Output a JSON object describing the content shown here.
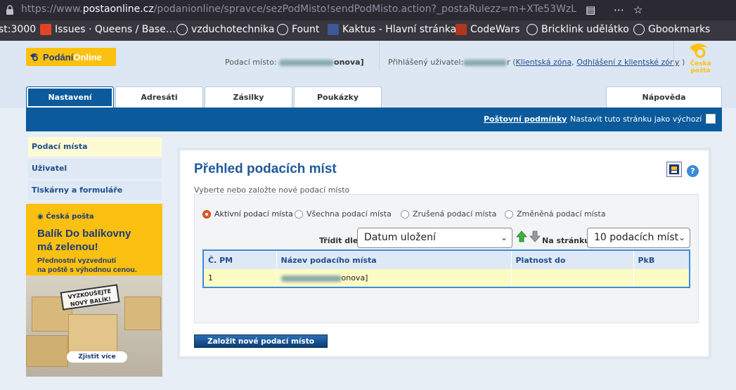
{
  "browser": {
    "url_prefix": "https://www.",
    "url_host": "postaonline.cz",
    "url_path": "/podanionline/spravce/sezPodMisto!sendPodMisto.action?_postaRulezz=m+XTe53WzL",
    "bookmarks": [
      {
        "label": "st:3000"
      },
      {
        "label": "Issues · Queens / Base…"
      },
      {
        "label": "vzduchotechnika"
      },
      {
        "label": "Fount"
      },
      {
        "label": "Kaktus - Hlavní stránka"
      },
      {
        "label": "CodeWars"
      },
      {
        "label": "Bricklink udělátko"
      },
      {
        "label": "Gbookmarks"
      }
    ]
  },
  "header": {
    "logo_part1": "Podání",
    "logo_part2": "Online",
    "podaci_misto_label": "Podací místo:",
    "podaci_misto_value": "onova]",
    "user_label": "Přihlášený uživatel:",
    "user_value": "r",
    "client_zone_link": "Klientská zóna",
    "logout_link": "Odhlášení z klientské zóny",
    "cp_logo": "Česká pošta"
  },
  "tabs": [
    {
      "label": "Nastavení"
    },
    {
      "label": "Adresáti"
    },
    {
      "label": "Zásilky"
    },
    {
      "label": "Poukázky"
    },
    {
      "label": "Nápověda"
    }
  ],
  "bluebar": {
    "conditions_link": "Poštovní podmínky",
    "set_default_label": "Nastavit tuto stránku jako výchozí"
  },
  "sidebar": {
    "items": [
      {
        "label": "Podací místa"
      },
      {
        "label": "Uživatel"
      },
      {
        "label": "Tiskárny a formuláře"
      }
    ]
  },
  "banner": {
    "brand": "Česká pošta",
    "headline_1": "Balík Do balíkovny",
    "headline_2": "má zelenou!",
    "text_1": "Přednostní vyzvednutí",
    "text_2": "na poště s výhodnou cenou.",
    "stamp_1": "VYZKOUŠEJTE",
    "stamp_2": "NOVÝ BALÍK!",
    "cta": "Zjistit více"
  },
  "main": {
    "title": "Přehled podacích míst",
    "subtitle": "Vyberte nebo založte nové podací místo",
    "help": "?",
    "filters": [
      {
        "label": "Aktivní podací místa",
        "selected": true
      },
      {
        "label": "Všechna podací místa",
        "selected": false
      },
      {
        "label": "Zrušená podací místa",
        "selected": false
      },
      {
        "label": "Změněná podací místa",
        "selected": false
      }
    ],
    "sort_label": "Třídit dle:",
    "sort_value": "Datum uložení",
    "per_page_label": "Na stránku:",
    "per_page_value": "10 podacích míst",
    "table": {
      "columns": [
        "Č. PM",
        "Název podacího místa",
        "Platnost do",
        "PkB"
      ],
      "rows": [
        [
          "1",
          "onova]",
          "",
          ""
        ]
      ]
    },
    "create_button": "Založit nové podací místo"
  },
  "colors": {
    "brand_blue": "#0a5a9c",
    "brand_yellow": "#fcc010",
    "row_highlight": "#fdfbc4",
    "radio_selected": "#e8562a"
  }
}
